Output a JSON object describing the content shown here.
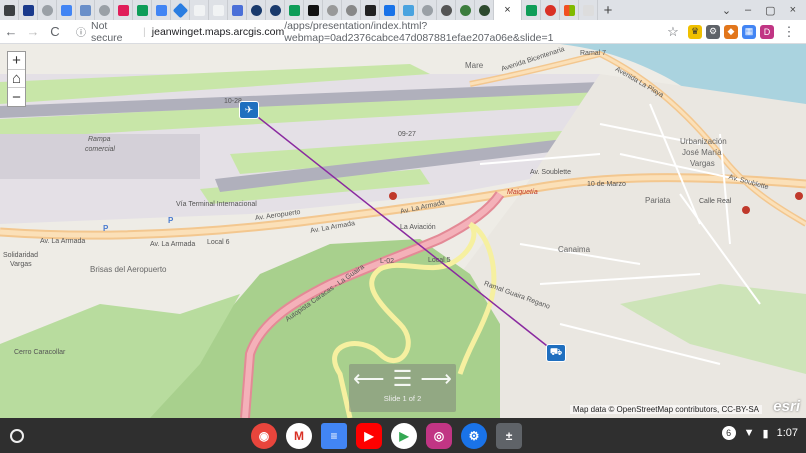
{
  "browser": {
    "tab_count_icons": [
      "grid",
      "star",
      "chrome",
      "docs",
      "sheets",
      "chrome",
      "slack",
      "sheets",
      "docs",
      "share",
      "blank",
      "edit",
      "circle",
      "circle",
      "sheets",
      "dark",
      "apple",
      "circle",
      "nyt",
      "play",
      "window",
      "chrome",
      "circle",
      "leaf",
      "circle"
    ],
    "active_tab_close": "×",
    "new_tab": "+",
    "window_controls": [
      "⌄",
      "–",
      "▢",
      "×"
    ],
    "back": "←",
    "forward": "→",
    "reload": "C",
    "lock_icon": "ⓘ",
    "not_secure": "Not secure",
    "separator": "|",
    "url_host": "jeanwinget.maps.arcgis.com",
    "url_path": "/apps/presentation/index.html?webmap=0ad2376cabce47d087881efae207a06e&slide=1",
    "star": "☆",
    "extensions": [
      "♛",
      "⚙",
      "◆",
      "▦",
      "D"
    ],
    "menu": "⋮"
  },
  "map": {
    "zoom_in": "+",
    "home": "⌂",
    "zoom_out": "−",
    "labels": {
      "mare": "Mare",
      "avenida_bicentenaria": "Avenida Bicentenaria",
      "ramal7": "Ramal 7",
      "avenida_la_playa": "Avenida La Playa",
      "av_soublette_top": "Av. Soublette",
      "urbanizacion": "Urbanización",
      "jose_maria": "José María",
      "vargas": "Vargas",
      "rampa": "Rampa",
      "comercial": "comercial",
      "runway": "09-27",
      "runway2": "10-28",
      "terminal": "Vía Terminal Internacional",
      "av_aeropuerto": "Av. Aeropuerto",
      "av_la_armada_1": "Av. La Armada",
      "av_la_armada_2": "Av. La Armada",
      "av_la_armada_3": "Av. La Armada",
      "local6": "Local 6",
      "la_aviacion": "La Aviación",
      "maiquetia": "Maiquetía",
      "av_soublette": "Av. Soublette",
      "diez_marzo": "10 de Marzo",
      "pariata": "Pariata",
      "calle_real": "Calle Real",
      "solidaridad": "Solidaridad",
      "vargas2": "Vargas",
      "brisas": "Brisas del Aeropuerto",
      "l02": "L-02",
      "local5": "Local 5",
      "autopista": "Autopista Caracas - La Guaira",
      "canaima": "Canaima",
      "ramal_guaira": "Ramal Guaira Regano",
      "cerro": "Cerro Caracollar",
      "parking_p": "P"
    },
    "slide_prev": "⟵",
    "slide_menu": "☰",
    "slide_next": "⟶",
    "slide_count": "Slide 1 of 2",
    "attribution": "Map data © OpenStreetMap contributors, CC-BY-SA",
    "esri": "esri"
  },
  "shelf": {
    "time": "1:07",
    "notif_count": "6",
    "wifi": "▼",
    "battery": "▮",
    "apps": [
      {
        "name": "Chrome",
        "glyph": "◉",
        "color": "#e8453c"
      },
      {
        "name": "Gmail",
        "glyph": "M",
        "color": "#d93025"
      },
      {
        "name": "Docs",
        "glyph": "≡",
        "color": "#4285f4"
      },
      {
        "name": "YouTube",
        "glyph": "▶",
        "color": "#ff0000"
      },
      {
        "name": "Play Store",
        "glyph": "▶",
        "color": "#34a853"
      },
      {
        "name": "Instagram",
        "glyph": "◎",
        "color": "#c13584"
      },
      {
        "name": "Settings",
        "glyph": "⚙",
        "color": "#1a73e8"
      },
      {
        "name": "Calculator",
        "glyph": "±",
        "color": "#5f6368"
      }
    ]
  }
}
